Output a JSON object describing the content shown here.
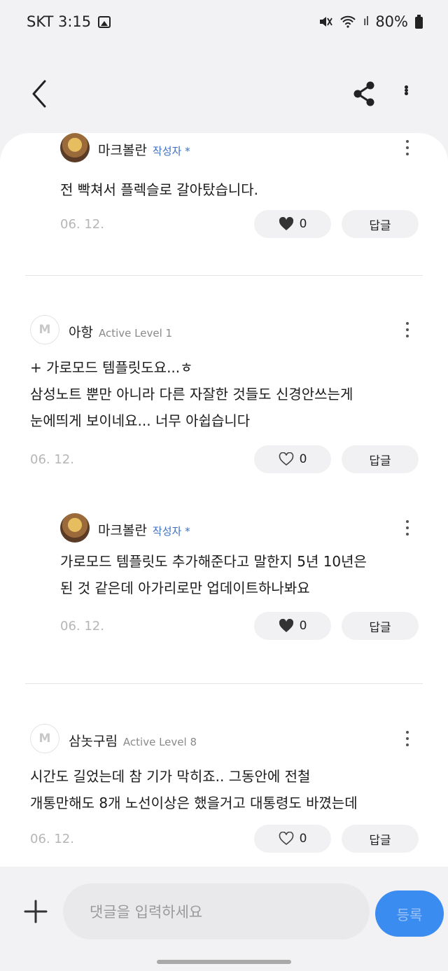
{
  "status": {
    "carrier_time": "SKT 3:15",
    "battery": "80%",
    "signal": "ıl"
  },
  "comments": [
    {
      "name": "마크볼란",
      "tag": "작성자 *",
      "text_lines": [
        "전 빡쳐서 플렉슬로 갈아탔습니다."
      ],
      "date": "06. 12.",
      "likes": "0",
      "reply": "답글",
      "liked": true
    },
    {
      "name": "아항",
      "tag": "Active Level 1",
      "text_lines": [
        "+ 가로모드 템플릿도요...ㅎ",
        "삼성노트 뿐만 아니라 다른 자잘한 것들도 신경안쓰는게",
        "눈에띄게 보이네요... 너무 아쉽습니다"
      ],
      "date": "06. 12.",
      "likes": "0",
      "reply": "답글",
      "liked": false
    },
    {
      "name": "마크볼란",
      "tag": "작성자 *",
      "text_lines": [
        "가로모드 템플릿도 추가해준다고 말한지 5년 10년은",
        "된 것 같은데 아가리로만 업데이트하나봐요"
      ],
      "date": "06. 12.",
      "likes": "0",
      "reply": "답글",
      "liked": true
    },
    {
      "name": "삼놋구림",
      "tag": "Active Level 8",
      "text_lines": [
        "시간도 길었는데 참 기가 막히죠.. 그동안에 전철",
        "개통만해도 8개 노선이상은 했을거고 대통령도 바꼈는데"
      ],
      "date": "06. 12.",
      "likes": "0",
      "reply": "답글",
      "liked": false
    }
  ],
  "input": {
    "placeholder": "댓글을 입력하세요",
    "submit_label": "등록"
  },
  "icons": {
    "back": "chevron-left-icon",
    "share": "share-icon",
    "more": "more-vertical-icon",
    "plus": "plus-icon",
    "heart": "heart-icon"
  },
  "colors": {
    "accent": "#3b8cf0",
    "author_tag": "#3b6fc4"
  }
}
